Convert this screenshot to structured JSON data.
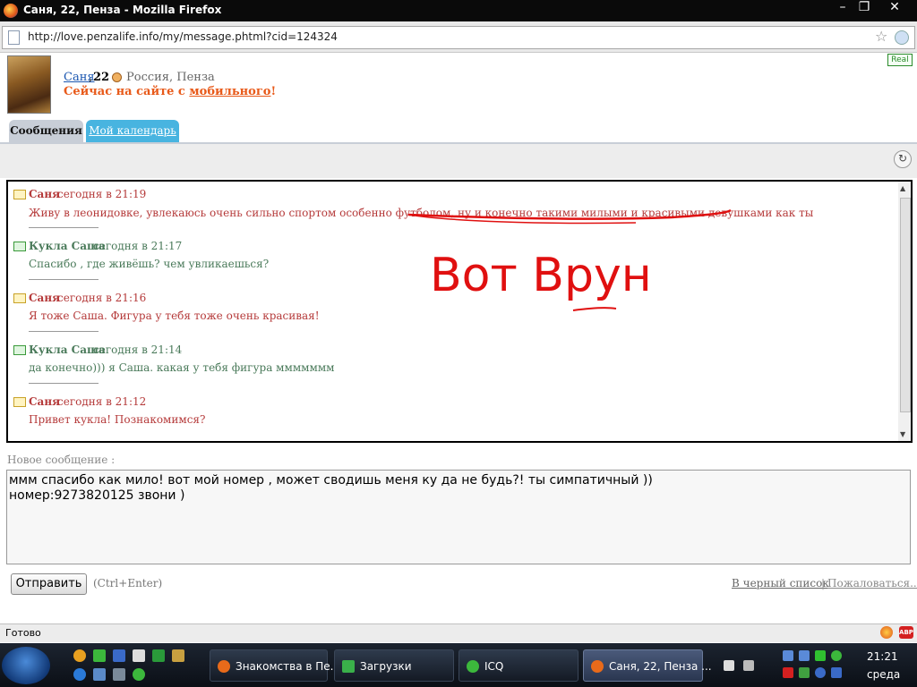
{
  "window": {
    "title": "Саня, 22, Пенза - Mozilla Firefox"
  },
  "browser": {
    "url": "http://love.penzalife.info/my/message.phtml?cid=124324",
    "status": "Готово"
  },
  "profile": {
    "name": "Саня",
    "age": "22",
    "location": "Россия, Пенза",
    "online_prefix": "Сейчас на сайте с ",
    "online_link": "мобильного",
    "online_suffix": "!",
    "badge": "Real"
  },
  "tabs": [
    {
      "label": "Сообщения"
    },
    {
      "label": "Мой календарь"
    }
  ],
  "messages": [
    {
      "author": "Саня",
      "time": "сегодня в 21:19",
      "text": "Живу в леонидовке, увлекаюсь очень сильно спортом особенно футболом, ну и конечно такими милыми и красивыми девушками как ты"
    },
    {
      "author": "Кукла Саша",
      "time": "сегодня в 21:17",
      "text": "Спасибо , где живёшь? чем увликаешься?"
    },
    {
      "author": "Саня",
      "time": "сегодня в 21:16",
      "text": "Я тоже Саша. Фигура у тебя тоже очень красивая!"
    },
    {
      "author": "Кукла Саша",
      "time": "сегодня в 21:14",
      "text": "да конечно))) я Саша. какая у тебя фигура ммммммм"
    },
    {
      "author": "Саня",
      "time": "сегодня в 21:12",
      "text": "Привет кукла! Познакомимся?"
    }
  ],
  "annotation": {
    "handwritten_text": "Вот Врун"
  },
  "compose": {
    "label": "Новое сообщение :",
    "line1": "ммм спасибо как мило! вот мой номер , может сводишь меня ку да не будь?! ты симпатичный ))",
    "line2": "номер:9273820125 звони )",
    "send_label": "Отправить",
    "hint": "(Ctrl+Enter)",
    "blacklist": "В черный список",
    "separator": "|",
    "complain": "Пожаловаться..."
  },
  "taskbar": {
    "tasks": [
      {
        "label": "Знакомства в Пе..."
      },
      {
        "label": "Загрузки"
      },
      {
        "label": "ICQ"
      },
      {
        "label": "Саня, 22, Пенза ..."
      }
    ],
    "time": "21:21",
    "day": "среда"
  },
  "colors": {
    "author_sanya": "#b53a3a",
    "author_kukla": "#4a7a5a",
    "online": "#e85a1a",
    "tab_active": "#c8ced7",
    "tab_inactive": "#48b4e0",
    "annotation": "#e01010"
  }
}
